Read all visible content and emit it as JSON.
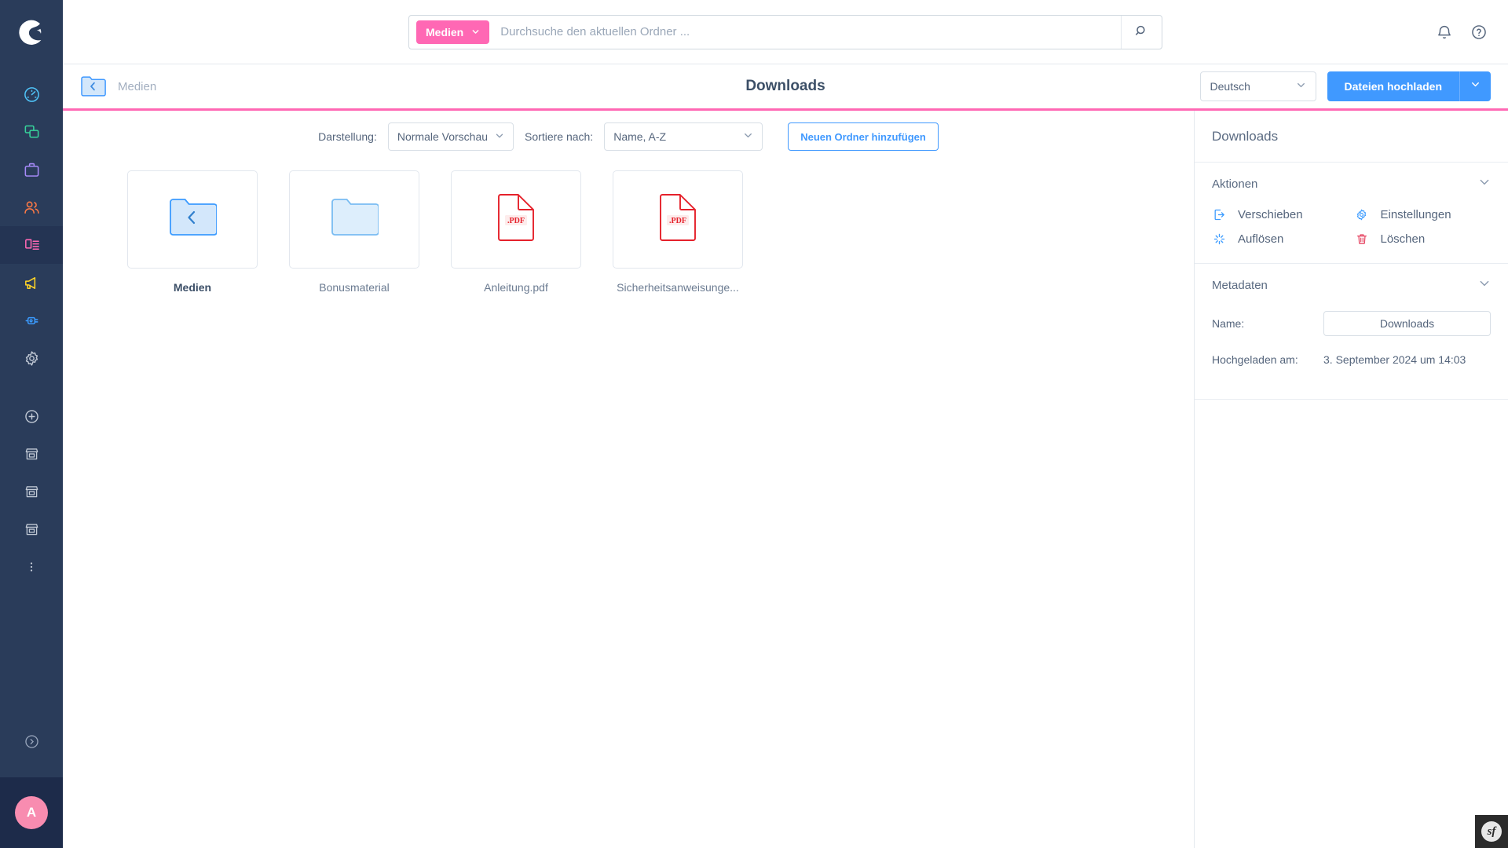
{
  "app": {
    "brand": "shopware-logo"
  },
  "sidebar": {
    "items": [
      {
        "name": "dashboard",
        "icon": "gauge-icon",
        "color": "#4fc3f7",
        "active": false
      },
      {
        "name": "catalogues",
        "icon": "copy-icon",
        "color": "#37d39b",
        "active": false
      },
      {
        "name": "orders",
        "icon": "briefcase-icon",
        "color": "#a78bfa",
        "active": false
      },
      {
        "name": "customers",
        "icon": "users-icon",
        "color": "#ff7a45",
        "active": false
      },
      {
        "name": "content",
        "icon": "content-icon",
        "color": "#ff68b4",
        "active": true
      },
      {
        "name": "marketing",
        "icon": "megaphone-icon",
        "color": "#ffd426",
        "active": false
      },
      {
        "name": "extensions",
        "icon": "plug-icon",
        "color": "#3b9bff",
        "active": false
      },
      {
        "name": "settings",
        "icon": "gear-icon",
        "color": "#c2cad6",
        "active": false
      }
    ],
    "shops": [
      {
        "name": "add-sales-channel",
        "icon": "plus-circle-icon"
      },
      {
        "name": "sales-channel-1",
        "icon": "storefront-icon"
      },
      {
        "name": "sales-channel-2",
        "icon": "storefront-icon"
      },
      {
        "name": "sales-channel-3",
        "icon": "storefront-icon"
      },
      {
        "name": "sales-channel-more",
        "icon": "ellipsis-vertical-icon"
      }
    ],
    "collapse": {
      "name": "collapse-sidebar",
      "icon": "chevron-right-circle-icon"
    },
    "avatar": {
      "initial": "A",
      "color": "#f88cb0"
    }
  },
  "search": {
    "scope_label": "Medien",
    "scope_caret": "chevron-down-icon",
    "placeholder": "Durchsuche den aktuellen Ordner ...",
    "value": "",
    "submit_icon": "search-icon"
  },
  "topbar_right": {
    "notifications_icon": "bell-icon",
    "help_icon": "question-circle-icon"
  },
  "header": {
    "back_icon": "folder-back-icon",
    "breadcrumb": "Medien",
    "title": "Downloads",
    "language": {
      "value": "Deutsch",
      "caret": "chevron-down-icon"
    },
    "upload_label": "Dateien hochladen",
    "upload_caret": "chevron-down-icon",
    "accent_color": "#ff68b4"
  },
  "toolbar": {
    "view_label": "Darstellung:",
    "view_value": "Normale Vorschau",
    "sort_label": "Sortiere nach:",
    "sort_value": "Name, A-Z",
    "new_folder_label": "Neuen Ordner hinzufügen"
  },
  "grid": {
    "items": [
      {
        "name": "Medien",
        "type": "folder-up",
        "bold": true
      },
      {
        "name": "Bonusmaterial",
        "type": "folder",
        "bold": false
      },
      {
        "name": "Anleitung.pdf",
        "type": "pdf",
        "bold": false,
        "badge": "PDF"
      },
      {
        "name": "Sicherheitsanweisunge...",
        "type": "pdf",
        "bold": false,
        "badge": "PDF"
      }
    ]
  },
  "panel": {
    "title": "Downloads",
    "actions_section": {
      "label": "Aktionen",
      "caret": "chevron-down-icon"
    },
    "actions": [
      {
        "label": "Verschieben",
        "icon": "move-icon",
        "color": "#3b9bff"
      },
      {
        "label": "Einstellungen",
        "icon": "gear-icon",
        "color": "#3b9bff"
      },
      {
        "label": "Auflösen",
        "icon": "dissolve-icon",
        "color": "#3b9bff"
      },
      {
        "label": "Löschen",
        "icon": "trash-icon",
        "color": "#e5405e"
      }
    ],
    "metadata_section": {
      "label": "Metadaten",
      "caret": "chevron-down-icon"
    },
    "metadata": [
      {
        "label": "Name:",
        "value": "Downloads",
        "input": true
      },
      {
        "label": "Hochgeladen am:",
        "value": "3. September 2024 um 14:03",
        "input": false
      }
    ]
  },
  "debug": {
    "symfony_label": "sf"
  }
}
